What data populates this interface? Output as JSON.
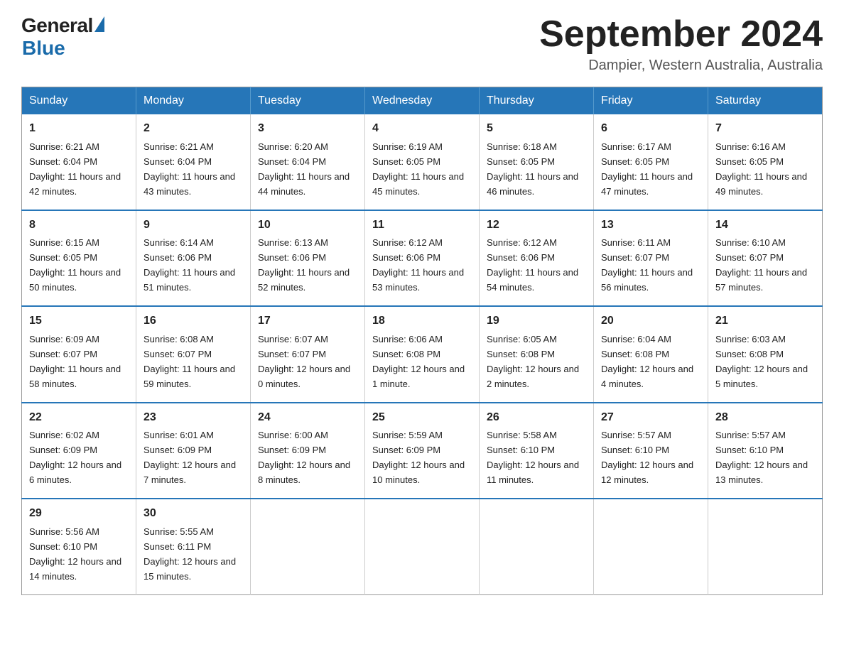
{
  "header": {
    "logo_general": "General",
    "logo_blue": "Blue",
    "month_title": "September 2024",
    "location": "Dampier, Western Australia, Australia"
  },
  "weekdays": [
    "Sunday",
    "Monday",
    "Tuesday",
    "Wednesday",
    "Thursday",
    "Friday",
    "Saturday"
  ],
  "weeks": [
    [
      {
        "day": "1",
        "sunrise": "6:21 AM",
        "sunset": "6:04 PM",
        "daylight": "11 hours and 42 minutes."
      },
      {
        "day": "2",
        "sunrise": "6:21 AM",
        "sunset": "6:04 PM",
        "daylight": "11 hours and 43 minutes."
      },
      {
        "day": "3",
        "sunrise": "6:20 AM",
        "sunset": "6:04 PM",
        "daylight": "11 hours and 44 minutes."
      },
      {
        "day": "4",
        "sunrise": "6:19 AM",
        "sunset": "6:05 PM",
        "daylight": "11 hours and 45 minutes."
      },
      {
        "day": "5",
        "sunrise": "6:18 AM",
        "sunset": "6:05 PM",
        "daylight": "11 hours and 46 minutes."
      },
      {
        "day": "6",
        "sunrise": "6:17 AM",
        "sunset": "6:05 PM",
        "daylight": "11 hours and 47 minutes."
      },
      {
        "day": "7",
        "sunrise": "6:16 AM",
        "sunset": "6:05 PM",
        "daylight": "11 hours and 49 minutes."
      }
    ],
    [
      {
        "day": "8",
        "sunrise": "6:15 AM",
        "sunset": "6:05 PM",
        "daylight": "11 hours and 50 minutes."
      },
      {
        "day": "9",
        "sunrise": "6:14 AM",
        "sunset": "6:06 PM",
        "daylight": "11 hours and 51 minutes."
      },
      {
        "day": "10",
        "sunrise": "6:13 AM",
        "sunset": "6:06 PM",
        "daylight": "11 hours and 52 minutes."
      },
      {
        "day": "11",
        "sunrise": "6:12 AM",
        "sunset": "6:06 PM",
        "daylight": "11 hours and 53 minutes."
      },
      {
        "day": "12",
        "sunrise": "6:12 AM",
        "sunset": "6:06 PM",
        "daylight": "11 hours and 54 minutes."
      },
      {
        "day": "13",
        "sunrise": "6:11 AM",
        "sunset": "6:07 PM",
        "daylight": "11 hours and 56 minutes."
      },
      {
        "day": "14",
        "sunrise": "6:10 AM",
        "sunset": "6:07 PM",
        "daylight": "11 hours and 57 minutes."
      }
    ],
    [
      {
        "day": "15",
        "sunrise": "6:09 AM",
        "sunset": "6:07 PM",
        "daylight": "11 hours and 58 minutes."
      },
      {
        "day": "16",
        "sunrise": "6:08 AM",
        "sunset": "6:07 PM",
        "daylight": "11 hours and 59 minutes."
      },
      {
        "day": "17",
        "sunrise": "6:07 AM",
        "sunset": "6:07 PM",
        "daylight": "12 hours and 0 minutes."
      },
      {
        "day": "18",
        "sunrise": "6:06 AM",
        "sunset": "6:08 PM",
        "daylight": "12 hours and 1 minute."
      },
      {
        "day": "19",
        "sunrise": "6:05 AM",
        "sunset": "6:08 PM",
        "daylight": "12 hours and 2 minutes."
      },
      {
        "day": "20",
        "sunrise": "6:04 AM",
        "sunset": "6:08 PM",
        "daylight": "12 hours and 4 minutes."
      },
      {
        "day": "21",
        "sunrise": "6:03 AM",
        "sunset": "6:08 PM",
        "daylight": "12 hours and 5 minutes."
      }
    ],
    [
      {
        "day": "22",
        "sunrise": "6:02 AM",
        "sunset": "6:09 PM",
        "daylight": "12 hours and 6 minutes."
      },
      {
        "day": "23",
        "sunrise": "6:01 AM",
        "sunset": "6:09 PM",
        "daylight": "12 hours and 7 minutes."
      },
      {
        "day": "24",
        "sunrise": "6:00 AM",
        "sunset": "6:09 PM",
        "daylight": "12 hours and 8 minutes."
      },
      {
        "day": "25",
        "sunrise": "5:59 AM",
        "sunset": "6:09 PM",
        "daylight": "12 hours and 10 minutes."
      },
      {
        "day": "26",
        "sunrise": "5:58 AM",
        "sunset": "6:10 PM",
        "daylight": "12 hours and 11 minutes."
      },
      {
        "day": "27",
        "sunrise": "5:57 AM",
        "sunset": "6:10 PM",
        "daylight": "12 hours and 12 minutes."
      },
      {
        "day": "28",
        "sunrise": "5:57 AM",
        "sunset": "6:10 PM",
        "daylight": "12 hours and 13 minutes."
      }
    ],
    [
      {
        "day": "29",
        "sunrise": "5:56 AM",
        "sunset": "6:10 PM",
        "daylight": "12 hours and 14 minutes."
      },
      {
        "day": "30",
        "sunrise": "5:55 AM",
        "sunset": "6:11 PM",
        "daylight": "12 hours and 15 minutes."
      },
      null,
      null,
      null,
      null,
      null
    ]
  ]
}
